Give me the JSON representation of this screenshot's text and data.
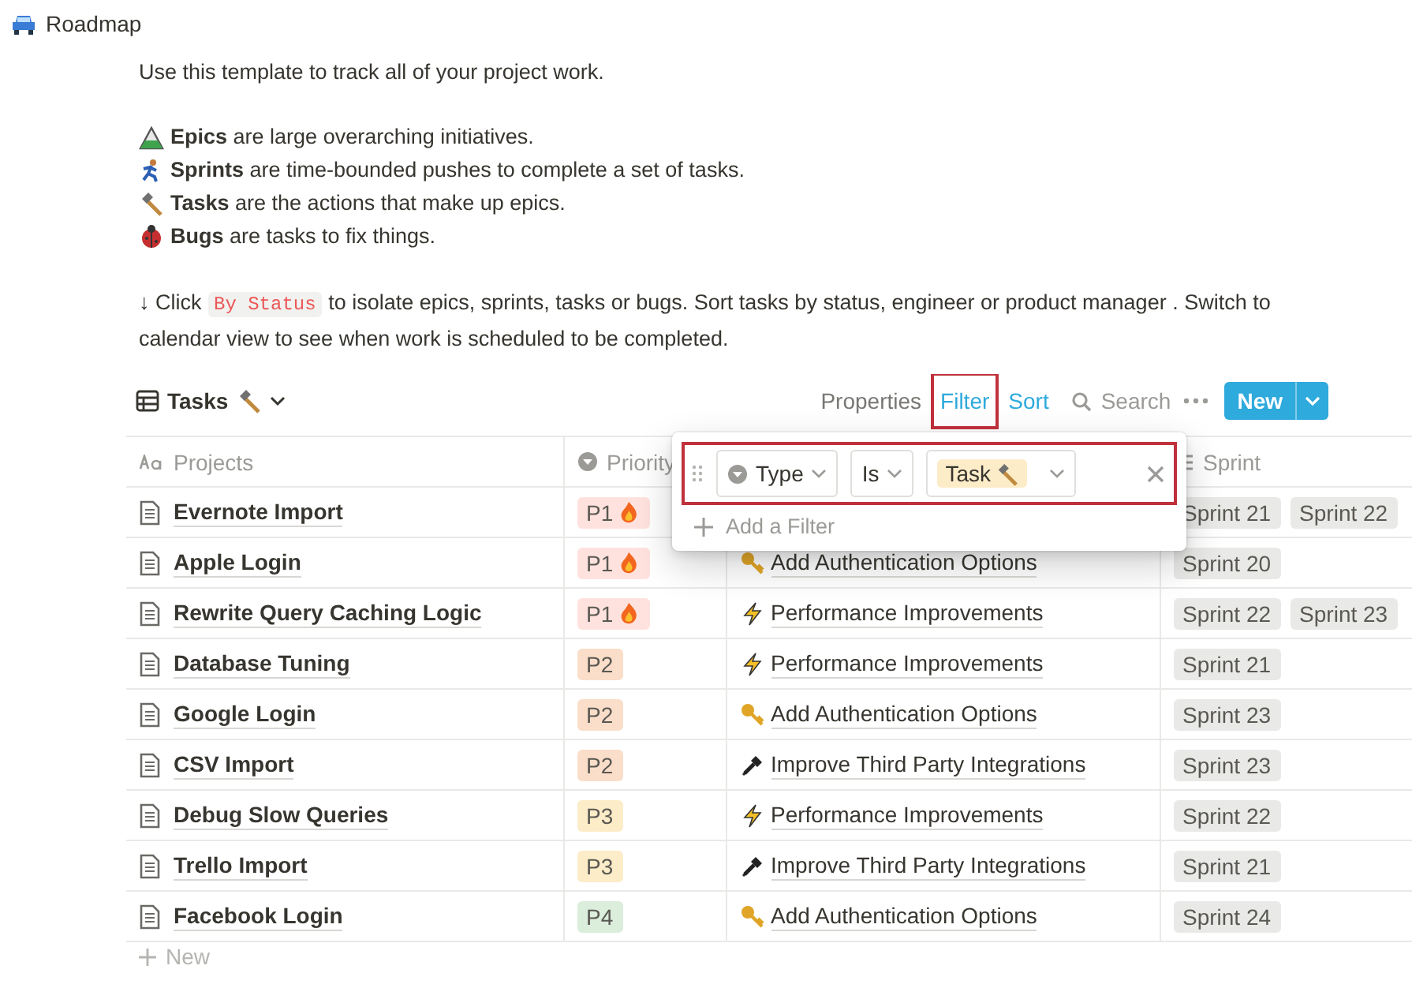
{
  "page": {
    "title": "Roadmap"
  },
  "intro": "Use this template to track all of your project work.",
  "legend": [
    {
      "kind": "mountain",
      "text": "**Epics** are large overarching initiatives."
    },
    {
      "kind": "runner",
      "text": "**Sprints** are time-bounded pushes to complete a set of tasks."
    },
    {
      "kind": "hammer",
      "text": "**Tasks** are the actions that make up epics."
    },
    {
      "kind": "bug",
      "text": "**Bugs** are tasks to fix things."
    }
  ],
  "instruction": {
    "before": "↓ Click",
    "code": "By Status",
    "after": "to isolate epics, sprints, tasks or bugs. Sort tasks by status, engineer or product manager . Switch to calendar view to see when work is scheduled to be completed."
  },
  "view": {
    "name": "Tasks"
  },
  "toolbar": {
    "properties": "Properties",
    "filter": {
      "label": "Filter",
      "active": true,
      "highlighted": true
    },
    "sort": {
      "label": "Sort",
      "active": true
    },
    "search": "Search",
    "new": "New"
  },
  "filter_popover": {
    "rule": {
      "property": "Type",
      "operator": "Is",
      "value": "Task",
      "highlighted": true
    },
    "add": "Add a Filter"
  },
  "table": {
    "columns": [
      {
        "kind": "title",
        "label": "Projects"
      },
      {
        "kind": "select",
        "label": "Priority"
      },
      {
        "kind": "multi",
        "label": "Sprint"
      }
    ],
    "rows": [
      {
        "project": "Evernote Import",
        "priority": {
          "label": "P1",
          "color": "#ffe2dd",
          "urgent": true
        },
        "sprints": [
          "Sprint 21",
          "Sprint 22"
        ]
      },
      {
        "project": "Apple Login",
        "priority": {
          "label": "P1",
          "color": "#ffe2dd",
          "urgent": true
        },
        "epic": {
          "kind": "auth",
          "text": "Add Authentication Options"
        },
        "sprints": [
          "Sprint 20"
        ]
      },
      {
        "project": "Rewrite Query Caching Logic",
        "priority": {
          "label": "P1",
          "color": "#ffe2dd",
          "urgent": true
        },
        "epic": {
          "kind": "performance",
          "text": "Performance Improvements"
        },
        "sprints": [
          "Sprint 22",
          "Sprint 23"
        ]
      },
      {
        "project": "Database Tuning",
        "priority": {
          "label": "P2",
          "color": "#fadec9",
          "urgent": false
        },
        "epic": {
          "kind": "performance",
          "text": "Performance Improvements"
        },
        "sprints": [
          "Sprint 21"
        ]
      },
      {
        "project": "Google Login",
        "priority": {
          "label": "P2",
          "color": "#fadec9",
          "urgent": false
        },
        "epic": {
          "kind": "auth",
          "text": "Add Authentication Options"
        },
        "sprints": [
          "Sprint 23"
        ]
      },
      {
        "project": "CSV Import",
        "priority": {
          "label": "P2",
          "color": "#fadec9",
          "urgent": false
        },
        "epic": {
          "kind": "integration",
          "text": "Improve Third Party Integrations"
        },
        "sprints": [
          "Sprint 23"
        ]
      },
      {
        "project": "Debug Slow Queries",
        "priority": {
          "label": "P3",
          "color": "#fdecc8",
          "urgent": false
        },
        "epic": {
          "kind": "performance",
          "text": "Performance Improvements"
        },
        "sprints": [
          "Sprint 22"
        ]
      },
      {
        "project": "Trello Import",
        "priority": {
          "label": "P3",
          "color": "#fdecc8",
          "urgent": false
        },
        "epic": {
          "kind": "integration",
          "text": "Improve Third Party Integrations"
        },
        "sprints": [
          "Sprint 21"
        ]
      },
      {
        "project": "Facebook Login",
        "priority": {
          "label": "P4",
          "color": "#dbeddb",
          "urgent": false
        },
        "epic": {
          "kind": "auth",
          "text": "Add Authentication Options"
        },
        "sprints": [
          "Sprint 24"
        ]
      }
    ],
    "new_row": "New"
  }
}
